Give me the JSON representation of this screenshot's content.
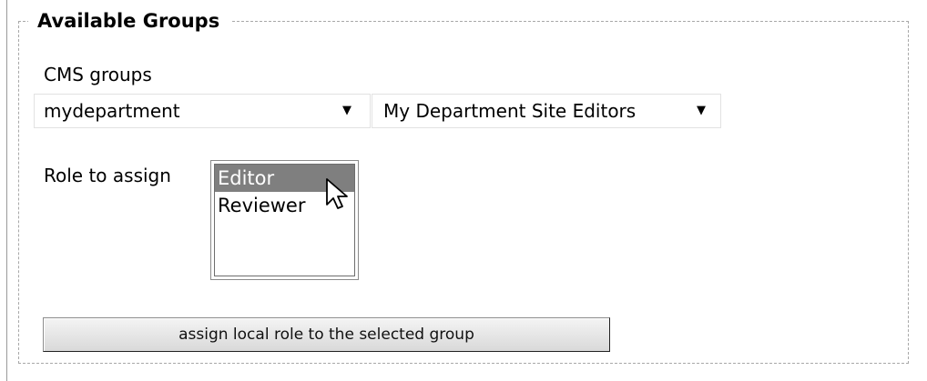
{
  "fieldset": {
    "legend": "Available Groups"
  },
  "cms_groups": {
    "label": "CMS groups",
    "department_select": {
      "value": "mydepartment",
      "arrow_icon": "dropdown-arrow-icon"
    },
    "group_select": {
      "value": "My Department Site Editors",
      "arrow_icon": "dropdown-arrow-icon"
    }
  },
  "role": {
    "label": "Role to assign",
    "options": [
      {
        "label": "Editor",
        "selected": true
      },
      {
        "label": "Reviewer",
        "selected": false
      }
    ],
    "selection_color": "#7f7f7f"
  },
  "assign_button": {
    "label": "assign local role to the selected group"
  }
}
